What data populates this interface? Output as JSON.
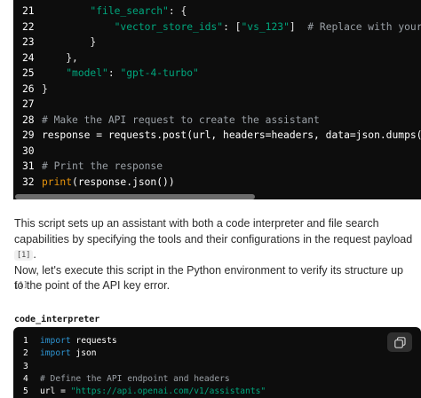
{
  "top_code": {
    "lines": [
      {
        "n": "21",
        "parts": [
          [
            "",
            "        "
          ],
          [
            "str",
            "\"file_search\""
          ],
          [
            "",
            ": {"
          ]
        ]
      },
      {
        "n": "22",
        "parts": [
          [
            "",
            "            "
          ],
          [
            "str",
            "\"vector_store_ids\""
          ],
          [
            "",
            ": ["
          ],
          [
            "str",
            "\"vs_123\""
          ],
          [
            "",
            "]  "
          ],
          [
            "cmt",
            "# Replace with your a"
          ]
        ]
      },
      {
        "n": "23",
        "parts": [
          [
            "",
            "        }"
          ]
        ]
      },
      {
        "n": "24",
        "parts": [
          [
            "",
            "    },"
          ]
        ]
      },
      {
        "n": "25",
        "parts": [
          [
            "",
            "    "
          ],
          [
            "str",
            "\"model\""
          ],
          [
            "",
            ": "
          ],
          [
            "str",
            "\"gpt-4-turbo\""
          ]
        ]
      },
      {
        "n": "26",
        "parts": [
          [
            "",
            "}"
          ]
        ]
      },
      {
        "n": "27",
        "parts": []
      },
      {
        "n": "28",
        "parts": [
          [
            "cmt",
            "# Make the API request to create the assistant"
          ]
        ]
      },
      {
        "n": "29",
        "parts": [
          [
            "white",
            "response = requests.post(url, headers=headers, data=json.dumps(da"
          ]
        ]
      },
      {
        "n": "30",
        "parts": []
      },
      {
        "n": "31",
        "parts": [
          [
            "cmt",
            "# Print the response"
          ]
        ]
      },
      {
        "n": "32",
        "parts": [
          [
            "fn",
            "print"
          ],
          [
            "white",
            "(response.json())"
          ]
        ]
      }
    ]
  },
  "prose": {
    "p1_text": "This script sets up an assistant with both a code interpreter and file search capabilities by specifying the tools and their configurations in the request payload ",
    "p1_cite": "[1]",
    "p1_end": ".",
    "p2_text": "Now, let's execute this script in the Python environment to verify its structure up to the point of the API key error.",
    "ref_note": "[1]"
  },
  "section_label": "code_interpreter",
  "bottom_code": {
    "copy_icon": "copy-icon",
    "lines": [
      {
        "n": "1",
        "parts": [
          [
            "kw",
            "import"
          ],
          [
            "white",
            " requests"
          ]
        ]
      },
      {
        "n": "2",
        "parts": [
          [
            "kw",
            "import"
          ],
          [
            "white",
            " json"
          ]
        ]
      },
      {
        "n": "3",
        "parts": []
      },
      {
        "n": "4",
        "parts": [
          [
            "cmt",
            "# Define the API endpoint and headers"
          ]
        ]
      },
      {
        "n": "5",
        "parts": [
          [
            "white",
            "url = "
          ],
          [
            "str",
            "\"https://api.openai.com/v1/assistants\""
          ]
        ]
      }
    ]
  },
  "colors": {
    "code_bg": "#0d0d0d",
    "string": "#00a67d",
    "comment": "#9aa0a6",
    "function": "#e9950c",
    "keyword": "#2e95d3"
  }
}
